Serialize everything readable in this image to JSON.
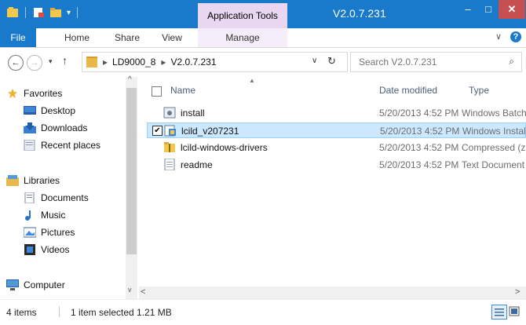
{
  "window": {
    "title": "V2.0.7.231",
    "context_tab": "Application Tools",
    "min_glyph": "–",
    "max_glyph": "□",
    "close_glyph": "✕"
  },
  "ribbon": {
    "tabs": [
      "File",
      "Home",
      "Share",
      "View",
      "Manage"
    ],
    "collapse_glyph": "∨",
    "help_glyph": "?"
  },
  "address": {
    "back_glyph": "←",
    "forward_glyph": "→",
    "recent_glyph": "▾",
    "up_glyph": "↑",
    "sep_glyph": "▸",
    "segments": [
      "LD9000_8",
      "V2.0.7.231"
    ],
    "dropdown_glyph": "∨",
    "refresh_glyph": "↻",
    "search_placeholder": "Search V2.0.7.231",
    "search_glyph": "⌕"
  },
  "nav": {
    "favorites": "Favorites",
    "favorite_items": [
      "Desktop",
      "Downloads",
      "Recent places"
    ],
    "libraries": "Libraries",
    "library_items": [
      "Documents",
      "Music",
      "Pictures",
      "Videos"
    ],
    "computer": "Computer"
  },
  "columns": {
    "name": "Name",
    "date": "Date modified",
    "type": "Type"
  },
  "files": [
    {
      "name": "install",
      "date": "5/20/2013 4:52 PM",
      "type": "Windows Batch File",
      "icon": "batch-file-icon",
      "selected": false
    },
    {
      "name": "lcild_v207231",
      "date": "5/20/2013 4:52 PM",
      "type": "Windows Installer Package",
      "icon": "installer-icon",
      "selected": true
    },
    {
      "name": "lcild-windows-drivers",
      "date": "5/20/2013 4:52 PM",
      "type": "Compressed (zipped) Folder",
      "icon": "zip-folder-icon",
      "selected": false
    },
    {
      "name": "readme",
      "date": "5/20/2013 4:52 PM",
      "type": "Text Document",
      "icon": "text-file-icon",
      "selected": false
    }
  ],
  "status": {
    "items": "4 items",
    "selection": "1 item selected  1.21 MB"
  },
  "colors": {
    "accent": "#1979ca",
    "context_tab": "#e9d7f2",
    "selected_row": "#cce8ff",
    "close_button": "#c74f4f"
  }
}
